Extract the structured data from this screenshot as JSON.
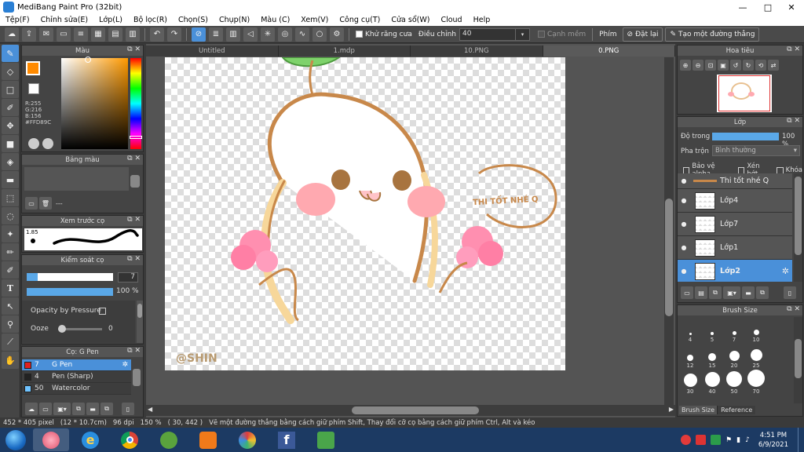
{
  "window": {
    "title": "MediBang Paint Pro (32bit)",
    "minimize": "—",
    "maximize": "□",
    "close": "✕"
  },
  "menu": [
    "Tệp(F)",
    "Chỉnh sửa(E)",
    "Lớp(L)",
    "Bộ lọc(R)",
    "Chọn(S)",
    "Chụp(N)",
    "Màu (C)",
    "Xem(V)",
    "Công cụ(T)",
    "Cửa sổ(W)",
    "Cloud",
    "Help"
  ],
  "toolbar": {
    "antialias_label": "Khử răng cưa",
    "adjust_label": "Điều chỉnh",
    "adjust_value": "40",
    "edge_label": "Cạnh mềm",
    "key_label": "Phím",
    "reset_label": "Đặt lại",
    "straight_label": "Tạo một đường thẳng"
  },
  "color_panel": {
    "title": "Màu",
    "r": "R:255",
    "g": "G:216",
    "b": "B:156",
    "hex": "#FFD89C",
    "fg_color": "#ff8a00",
    "main_color": "#FFD89C"
  },
  "palette_panel": {
    "title": "Bảng màu",
    "dash": "---"
  },
  "brush_preview": {
    "title": "Xem trước cọ",
    "size": "1.85"
  },
  "brush_control": {
    "title": "Kiểm soát cọ",
    "size_value": "7",
    "opacity_value": "100 %",
    "opacity_pressure": "Opacity by Pressure",
    "ooze_label": "Ooze",
    "ooze_value": "0"
  },
  "brush_list": {
    "title": "Cọ: G Pen",
    "items": [
      {
        "size": "7",
        "name": "G Pen",
        "color": "#e02020"
      },
      {
        "size": "4",
        "name": "Pen (Sharp)",
        "color": "#222222"
      },
      {
        "size": "50",
        "name": "Watercolor",
        "color": "#6fc3ff"
      }
    ]
  },
  "doc_tabs": [
    "Untitled",
    "1.mdp",
    "10.PNG",
    "0.PNG"
  ],
  "artwork": {
    "caption": "THI TỐT NHÉ Q",
    "signature": "@SHIN"
  },
  "navigator": {
    "title": "Hoa tiêu"
  },
  "layer_panel": {
    "title": "Lớp",
    "opacity_label": "Độ trong",
    "opacity_value": "100 %",
    "opacity_fraction": 1.0,
    "blend_label": "Pha trộn",
    "blend_value": "Bình thường",
    "protect_alpha": "Bảo vệ alpha",
    "clip": "Xén bớt",
    "lock": "Khóa",
    "layers": [
      "Thi tốt nhé Q",
      "Lớp4",
      "Lớp7",
      "Lớp1",
      "Lớp2"
    ]
  },
  "brush_size": {
    "title": "Brush Size",
    "sizes": [
      "4",
      "5",
      "7",
      "10",
      "12",
      "15",
      "20",
      "25",
      "30",
      "40",
      "50",
      "70"
    ],
    "tab_brush": "Brush Size",
    "tab_ref": "Reference"
  },
  "status": {
    "dims": "452 * 405 pixel",
    "cm": "(12 * 10.7cm)",
    "dpi": "96 dpi",
    "zoom": "150 %",
    "coords": "( 30, 442 )",
    "hint": "Vẽ một đường thẳng bằng cách giữ phím Shift, Thay đổi cỡ cọ bằng cách giữ phím Ctrl, Alt và kéo"
  },
  "clock": {
    "time": "4:51 PM",
    "date": "6/9/2021"
  }
}
